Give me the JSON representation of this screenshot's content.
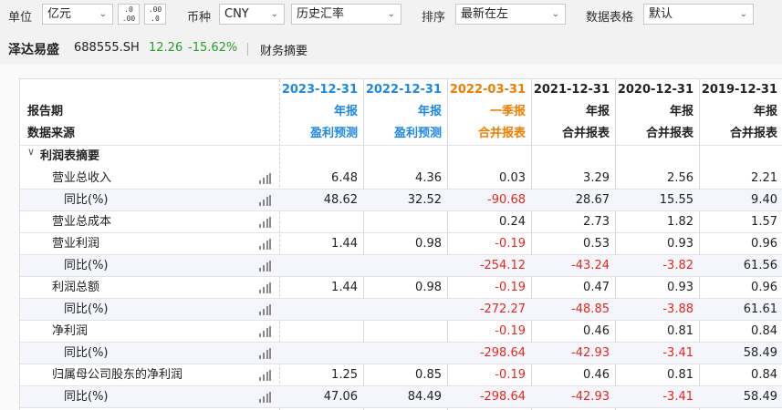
{
  "toolbar": {
    "unit_label": "单位",
    "unit_value": "亿元",
    "decimal_decrease": ".00 ←.0",
    "decimal_increase": ".00 →.0",
    "currency_label": "币种",
    "currency_value": "CNY",
    "rate_value": "历史汇率",
    "sort_label": "排序",
    "sort_value": "最新在左",
    "format_label": "数据表格",
    "format_value": "默认"
  },
  "stock": {
    "name": "泽达易盛",
    "code": "688555.SH",
    "price": "12.26",
    "change": "-15.62%",
    "summary": "财务摘要"
  },
  "table": {
    "header_labels": {
      "period": "报告期",
      "source": "数据来源"
    },
    "columns": [
      {
        "date": "2023-12-31",
        "type": "年报",
        "source": "盈利预测"
      },
      {
        "date": "2022-12-31",
        "type": "年报",
        "source": "盈利预测"
      },
      {
        "date": "2022-03-31",
        "type": "一季报",
        "source": "合并报表"
      },
      {
        "date": "2021-12-31",
        "type": "年报",
        "source": "合并报表"
      },
      {
        "date": "2020-12-31",
        "type": "年报",
        "source": "合并报表"
      },
      {
        "date": "2019-12-31",
        "type": "年报",
        "source": "合并报表"
      }
    ],
    "section_title": "利润表摘要",
    "rows": [
      {
        "label": "营业总收入",
        "values": [
          "6.48",
          "4.36",
          "0.03",
          "3.29",
          "2.56",
          "2.21"
        ]
      },
      {
        "label": "同比(%)",
        "values": [
          "48.62",
          "32.52",
          "-90.68",
          "28.67",
          "15.55",
          "9.40"
        ]
      },
      {
        "label": "营业总成本",
        "values": [
          "",
          "",
          "0.24",
          "2.73",
          "1.82",
          "1.57"
        ]
      },
      {
        "label": "营业利润",
        "values": [
          "1.44",
          "0.98",
          "-0.19",
          "0.53",
          "0.93",
          "0.96"
        ]
      },
      {
        "label": "同比(%)",
        "values": [
          "",
          "",
          "-254.12",
          "-43.24",
          "-3.82",
          "61.56"
        ]
      },
      {
        "label": "利润总额",
        "values": [
          "1.44",
          "0.98",
          "-0.19",
          "0.47",
          "0.93",
          "0.96"
        ]
      },
      {
        "label": "同比(%)",
        "values": [
          "",
          "",
          "-272.27",
          "-48.85",
          "-3.88",
          "61.61"
        ]
      },
      {
        "label": "净利润",
        "values": [
          "",
          "",
          "-0.19",
          "0.46",
          "0.81",
          "0.84"
        ]
      },
      {
        "label": "同比(%)",
        "values": [
          "",
          "",
          "-298.64",
          "-42.93",
          "-3.41",
          "58.49"
        ]
      },
      {
        "label": "归属母公司股东的净利润",
        "values": [
          "1.25",
          "0.85",
          "-0.19",
          "0.46",
          "0.81",
          "0.84"
        ]
      },
      {
        "label": "同比(%)",
        "values": [
          "47.06",
          "84.49",
          "-298.64",
          "-42.93",
          "-3.41",
          "58.49"
        ]
      }
    ]
  },
  "colors": {
    "estimate_blue": "#1e88e5",
    "q1_orange": "#f07d00",
    "negative_red": "#e8261d",
    "price_green": "#2a9d2a"
  }
}
